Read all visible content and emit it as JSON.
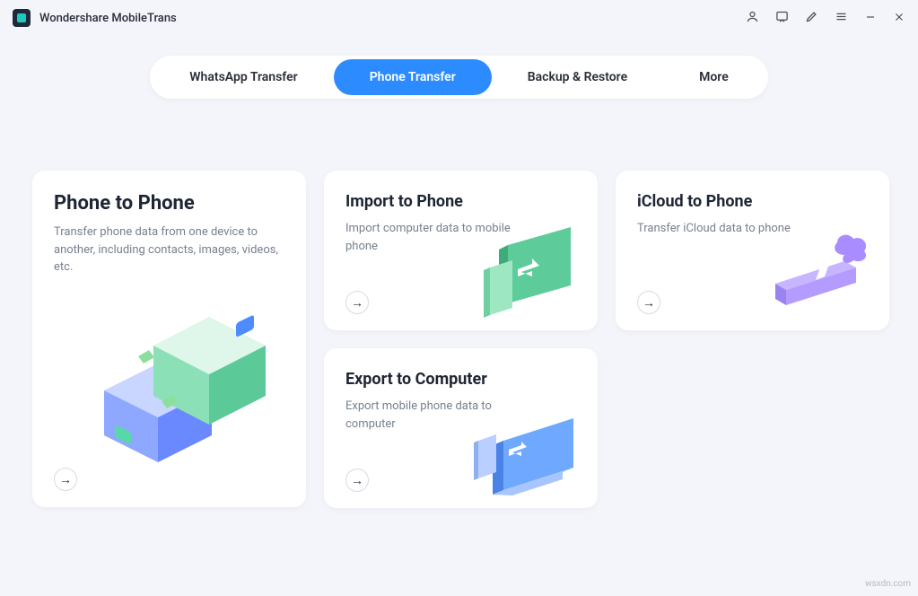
{
  "header": {
    "app_name": "Wondershare MobileTrans"
  },
  "tabs": {
    "whatsapp": "WhatsApp Transfer",
    "phone": "Phone Transfer",
    "backup": "Backup & Restore",
    "more": "More"
  },
  "cards": {
    "phone_to_phone": {
      "title": "Phone to Phone",
      "desc": "Transfer phone data from one device to another, including contacts, images, videos, etc."
    },
    "import": {
      "title": "Import to Phone",
      "desc": "Import computer data to mobile phone"
    },
    "icloud": {
      "title": "iCloud to Phone",
      "desc": "Transfer iCloud data to phone"
    },
    "export": {
      "title": "Export to Computer",
      "desc": "Export mobile phone data to computer"
    }
  },
  "arrow_glyph": "→",
  "watermark": "wsxdn.com"
}
